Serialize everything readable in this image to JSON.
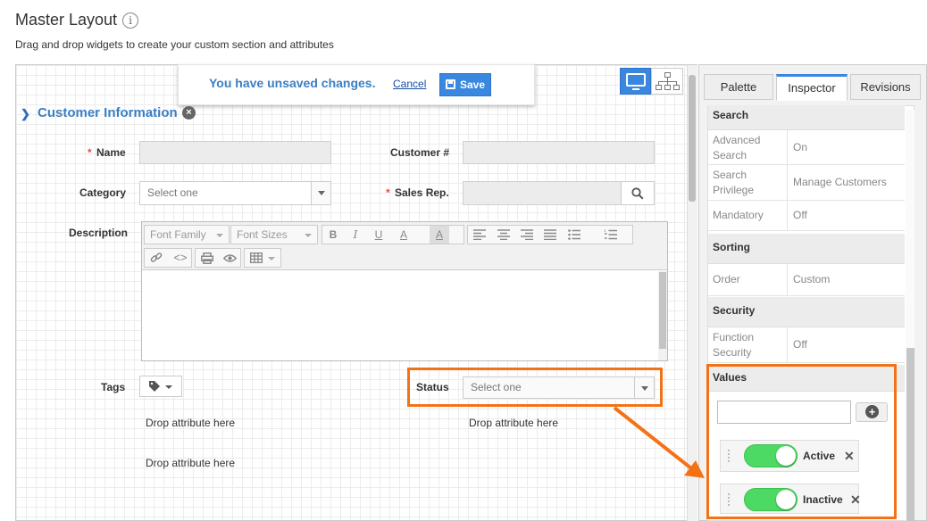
{
  "page": {
    "title": "Master Layout",
    "subtitle": "Drag and drop widgets to create your custom section and attributes"
  },
  "notice": {
    "message": "You have unsaved changes.",
    "cancel_label": "Cancel",
    "save_label": "Save"
  },
  "section": {
    "title": "Customer Information"
  },
  "fields": {
    "name": {
      "label": "Name",
      "required": "*"
    },
    "customer_no": {
      "label": "Customer #"
    },
    "category": {
      "label": "Category",
      "placeholder": "Select one"
    },
    "sales_rep": {
      "label": "Sales Rep.",
      "required": "*"
    },
    "description": {
      "label": "Description"
    },
    "tags": {
      "label": "Tags"
    },
    "status": {
      "label": "Status",
      "placeholder": "Select one"
    }
  },
  "editor_toolbar": {
    "font_family": "Font Family",
    "font_sizes": "Font Sizes",
    "bold": "B",
    "italic": "I",
    "underline": "U",
    "font_color": "A",
    "bg_color": "A"
  },
  "drop_zones": [
    "Drop attribute here",
    "Drop attribute here",
    "Drop attribute here"
  ],
  "panel": {
    "tabs": [
      "Palette",
      "Inspector",
      "Revisions"
    ],
    "active_tab": "Inspector",
    "sections": {
      "search": {
        "header": "Search",
        "rows": [
          {
            "key": "Advanced Search",
            "value": "On"
          },
          {
            "key": "Search Privilege",
            "value": "Manage Customers"
          },
          {
            "key": "Mandatory",
            "value": "Off"
          }
        ]
      },
      "sorting": {
        "header": "Sorting",
        "rows": [
          {
            "key": "Order",
            "value": "Custom"
          }
        ]
      },
      "security": {
        "header": "Security",
        "rows": [
          {
            "key": "Function Security",
            "value": "Off"
          }
        ]
      },
      "values": {
        "header": "Values",
        "items": [
          {
            "label": "Active",
            "enabled": true
          },
          {
            "label": "Inactive",
            "enabled": true
          }
        ]
      }
    }
  },
  "icons": [
    "info-icon",
    "save-icon",
    "desktop-view-icon",
    "hierarchy-view-icon",
    "chevron-down-icon",
    "close-icon",
    "search-icon",
    "tag-icon",
    "add-icon",
    "drag-handle-icon"
  ],
  "colors": {
    "accent": "#3a87e0",
    "highlight": "#f47216",
    "toggle_on": "#4cd964",
    "required": "#d9534f"
  }
}
